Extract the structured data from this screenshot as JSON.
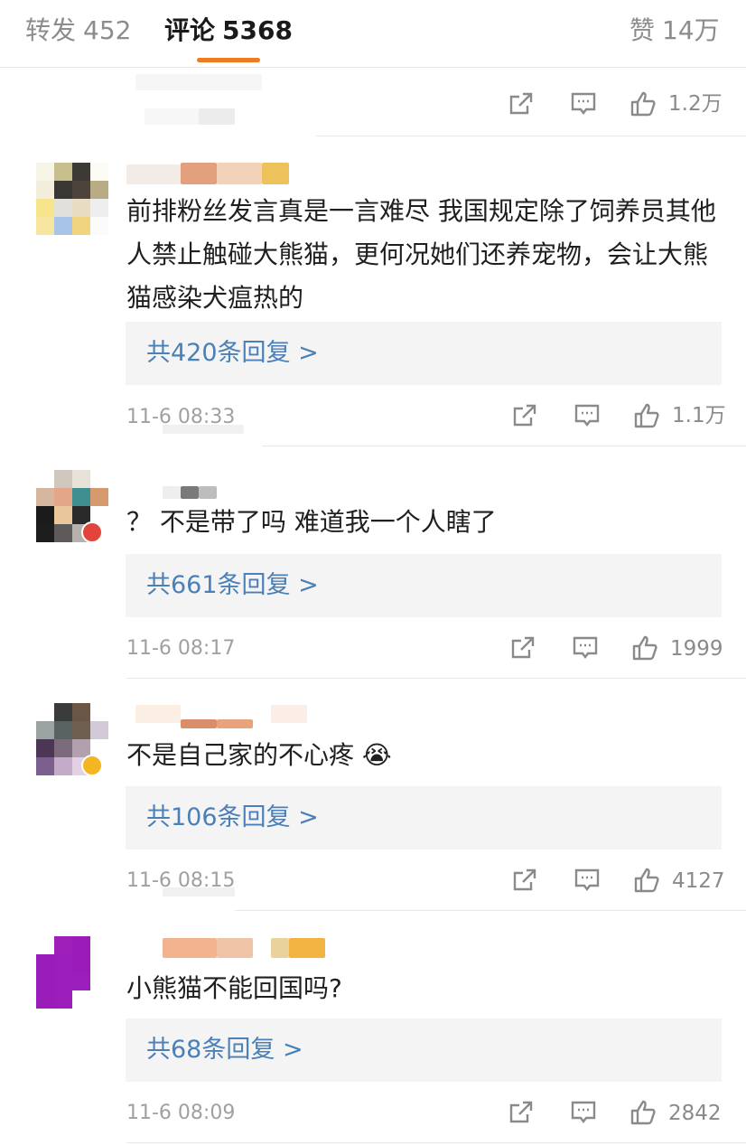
{
  "tabs": [
    {
      "label": "转发",
      "count": "452"
    },
    {
      "label": "评论",
      "count": "5368"
    },
    {
      "label": "赞",
      "count": "14万"
    }
  ],
  "top_partial": {
    "like_count": "1.2万"
  },
  "comments": [
    {
      "text": "前排粉丝发言真是一言难尽  我国规定除了饲养员其他人禁止触碰大熊猫，更何况她们还养宠物，会让大熊猫感染犬瘟热的",
      "reply_summary": "共420条回复 >",
      "time": "11-6 08:33",
      "likes": "1.1万"
    },
    {
      "text": "？ 不是带了吗 难道我一个人瞎了",
      "reply_summary": "共661条回复 >",
      "time": "11-6 08:17",
      "likes": "1999"
    },
    {
      "text": "不是自己家的不心疼 😭",
      "reply_summary": "共106条回复 >",
      "time": "11-6 08:15",
      "likes": "4127"
    },
    {
      "text": "小熊猫不能回国吗?",
      "reply_summary": "共68条回复 >",
      "time": "11-6 08:09",
      "likes": "2842"
    }
  ],
  "icons": {
    "share": "share-icon",
    "comment": "comment-icon",
    "like": "thumbs-up-icon"
  },
  "colors": {
    "accent": "#f07a1f",
    "link": "#4a7fb8",
    "muted": "#8c8c8c",
    "reply_bg": "#f4f4f4"
  }
}
